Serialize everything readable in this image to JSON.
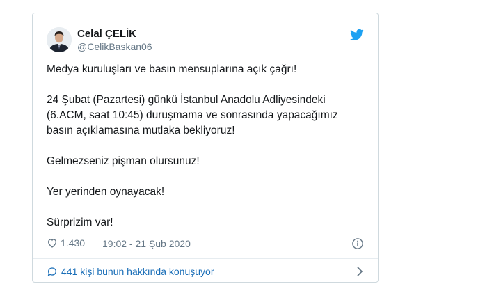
{
  "tweet": {
    "display_name": "Celal ÇELİK",
    "handle": "@CelikBaskan06",
    "paragraphs": [
      "Medya kuruluşları ve basın mensuplarına açık çağrı!",
      "24 Şubat (Pazartesi) günkü İstanbul Anadolu Adliyesindeki (6.ACM, saat 10:45) duruşmama ve sonrasında yapacağımız basın açıklamasına mutlaka bekliyoruz!",
      "Gelmezseniz pişman olursunuz!",
      "Yer yerinden oynayacak!",
      "Sürprizim var!"
    ],
    "likes": "1.430",
    "timestamp": "19:02 - 21 Şub 2020",
    "conversation": "441 kişi bunun hakkında konuşuyor"
  },
  "icons": {
    "brand": "twitter-bird-icon",
    "like": "heart-icon",
    "info": "info-icon",
    "conversation": "speech-bubble-icon",
    "more": "chevron-right-icon"
  },
  "colors": {
    "twitter_blue": "#1da1f2",
    "link_blue": "#1b6fb8",
    "secondary_text": "#657786",
    "border": "#cfd9de"
  }
}
